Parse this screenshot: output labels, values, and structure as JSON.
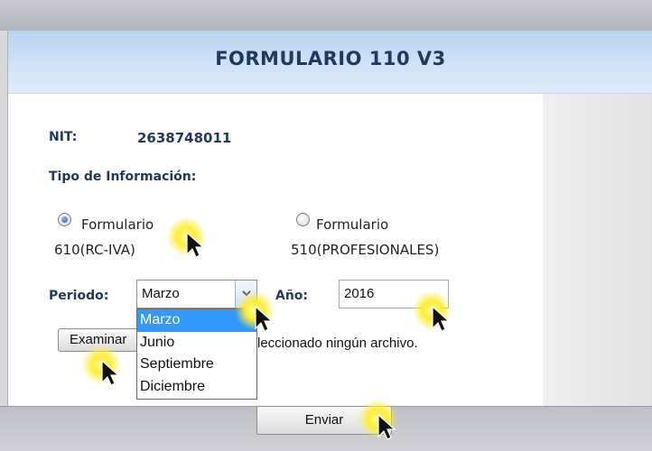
{
  "form": {
    "title": "FORMULARIO 110 V3",
    "nit_label": "NIT:",
    "nit_value": "2638748011",
    "tipo_label": "Tipo de Información:",
    "radio_1": {
      "line1": "Formulario",
      "line2": "610(RC-IVA)",
      "checked": true
    },
    "radio_2": {
      "line1": "Formulario",
      "line2": "510(PROFESIONALES)",
      "checked": false
    },
    "periodo_label": "Periodo:",
    "periodo_value": "Marzo",
    "periodo_options": [
      "Marzo",
      "Junio",
      "Septiembre",
      "Diciembre"
    ],
    "periodo_selected_index": 0,
    "anio_label": "Año:",
    "anio_value": "2016",
    "browse_label": "Examinar",
    "file_status": "leccionado ningún archivo.",
    "submit_label": "Enviar"
  },
  "icons": [
    "radio-checked-icon",
    "radio-unchecked-icon",
    "chevron-down-icon",
    "mouse-cursor-icon"
  ],
  "colors": {
    "header_text": "#1e3a5f",
    "selection": "#3399ff",
    "click_highlight": "#ffee33"
  }
}
